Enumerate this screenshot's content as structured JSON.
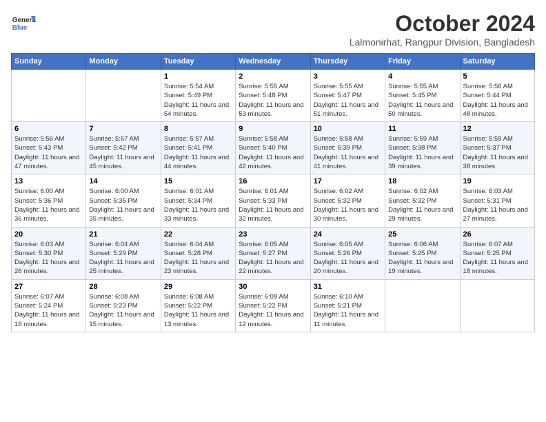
{
  "header": {
    "logo_general": "General",
    "logo_blue": "Blue",
    "month_title": "October 2024",
    "location": "Lalmonirhat, Rangpur Division, Bangladesh"
  },
  "weekdays": [
    "Sunday",
    "Monday",
    "Tuesday",
    "Wednesday",
    "Thursday",
    "Friday",
    "Saturday"
  ],
  "weeks": [
    [
      {
        "day": "",
        "sunrise": "",
        "sunset": "",
        "daylight": ""
      },
      {
        "day": "",
        "sunrise": "",
        "sunset": "",
        "daylight": ""
      },
      {
        "day": "1",
        "sunrise": "Sunrise: 5:54 AM",
        "sunset": "Sunset: 5:49 PM",
        "daylight": "Daylight: 11 hours and 54 minutes."
      },
      {
        "day": "2",
        "sunrise": "Sunrise: 5:55 AM",
        "sunset": "Sunset: 5:48 PM",
        "daylight": "Daylight: 11 hours and 53 minutes."
      },
      {
        "day": "3",
        "sunrise": "Sunrise: 5:55 AM",
        "sunset": "Sunset: 5:47 PM",
        "daylight": "Daylight: 11 hours and 51 minutes."
      },
      {
        "day": "4",
        "sunrise": "Sunrise: 5:55 AM",
        "sunset": "Sunset: 5:45 PM",
        "daylight": "Daylight: 11 hours and 50 minutes."
      },
      {
        "day": "5",
        "sunrise": "Sunrise: 5:56 AM",
        "sunset": "Sunset: 5:44 PM",
        "daylight": "Daylight: 11 hours and 48 minutes."
      }
    ],
    [
      {
        "day": "6",
        "sunrise": "Sunrise: 5:56 AM",
        "sunset": "Sunset: 5:43 PM",
        "daylight": "Daylight: 11 hours and 47 minutes."
      },
      {
        "day": "7",
        "sunrise": "Sunrise: 5:57 AM",
        "sunset": "Sunset: 5:42 PM",
        "daylight": "Daylight: 11 hours and 45 minutes."
      },
      {
        "day": "8",
        "sunrise": "Sunrise: 5:57 AM",
        "sunset": "Sunset: 5:41 PM",
        "daylight": "Daylight: 11 hours and 44 minutes."
      },
      {
        "day": "9",
        "sunrise": "Sunrise: 5:58 AM",
        "sunset": "Sunset: 5:40 PM",
        "daylight": "Daylight: 11 hours and 42 minutes."
      },
      {
        "day": "10",
        "sunrise": "Sunrise: 5:58 AM",
        "sunset": "Sunset: 5:39 PM",
        "daylight": "Daylight: 11 hours and 41 minutes."
      },
      {
        "day": "11",
        "sunrise": "Sunrise: 5:59 AM",
        "sunset": "Sunset: 5:38 PM",
        "daylight": "Daylight: 11 hours and 39 minutes."
      },
      {
        "day": "12",
        "sunrise": "Sunrise: 5:59 AM",
        "sunset": "Sunset: 5:37 PM",
        "daylight": "Daylight: 11 hours and 38 minutes."
      }
    ],
    [
      {
        "day": "13",
        "sunrise": "Sunrise: 6:00 AM",
        "sunset": "Sunset: 5:36 PM",
        "daylight": "Daylight: 11 hours and 36 minutes."
      },
      {
        "day": "14",
        "sunrise": "Sunrise: 6:00 AM",
        "sunset": "Sunset: 5:35 PM",
        "daylight": "Daylight: 11 hours and 35 minutes."
      },
      {
        "day": "15",
        "sunrise": "Sunrise: 6:01 AM",
        "sunset": "Sunset: 5:34 PM",
        "daylight": "Daylight: 11 hours and 33 minutes."
      },
      {
        "day": "16",
        "sunrise": "Sunrise: 6:01 AM",
        "sunset": "Sunset: 5:33 PM",
        "daylight": "Daylight: 11 hours and 32 minutes."
      },
      {
        "day": "17",
        "sunrise": "Sunrise: 6:02 AM",
        "sunset": "Sunset: 5:32 PM",
        "daylight": "Daylight: 11 hours and 30 minutes."
      },
      {
        "day": "18",
        "sunrise": "Sunrise: 6:02 AM",
        "sunset": "Sunset: 5:32 PM",
        "daylight": "Daylight: 11 hours and 29 minutes."
      },
      {
        "day": "19",
        "sunrise": "Sunrise: 6:03 AM",
        "sunset": "Sunset: 5:31 PM",
        "daylight": "Daylight: 11 hours and 27 minutes."
      }
    ],
    [
      {
        "day": "20",
        "sunrise": "Sunrise: 6:03 AM",
        "sunset": "Sunset: 5:30 PM",
        "daylight": "Daylight: 11 hours and 26 minutes."
      },
      {
        "day": "21",
        "sunrise": "Sunrise: 6:04 AM",
        "sunset": "Sunset: 5:29 PM",
        "daylight": "Daylight: 11 hours and 25 minutes."
      },
      {
        "day": "22",
        "sunrise": "Sunrise: 6:04 AM",
        "sunset": "Sunset: 5:28 PM",
        "daylight": "Daylight: 11 hours and 23 minutes."
      },
      {
        "day": "23",
        "sunrise": "Sunrise: 6:05 AM",
        "sunset": "Sunset: 5:27 PM",
        "daylight": "Daylight: 11 hours and 22 minutes."
      },
      {
        "day": "24",
        "sunrise": "Sunrise: 6:05 AM",
        "sunset": "Sunset: 5:26 PM",
        "daylight": "Daylight: 11 hours and 20 minutes."
      },
      {
        "day": "25",
        "sunrise": "Sunrise: 6:06 AM",
        "sunset": "Sunset: 5:25 PM",
        "daylight": "Daylight: 11 hours and 19 minutes."
      },
      {
        "day": "26",
        "sunrise": "Sunrise: 6:07 AM",
        "sunset": "Sunset: 5:25 PM",
        "daylight": "Daylight: 11 hours and 18 minutes."
      }
    ],
    [
      {
        "day": "27",
        "sunrise": "Sunrise: 6:07 AM",
        "sunset": "Sunset: 5:24 PM",
        "daylight": "Daylight: 11 hours and 16 minutes."
      },
      {
        "day": "28",
        "sunrise": "Sunrise: 6:08 AM",
        "sunset": "Sunset: 5:23 PM",
        "daylight": "Daylight: 11 hours and 15 minutes."
      },
      {
        "day": "29",
        "sunrise": "Sunrise: 6:08 AM",
        "sunset": "Sunset: 5:22 PM",
        "daylight": "Daylight: 11 hours and 13 minutes."
      },
      {
        "day": "30",
        "sunrise": "Sunrise: 6:09 AM",
        "sunset": "Sunset: 5:22 PM",
        "daylight": "Daylight: 11 hours and 12 minutes."
      },
      {
        "day": "31",
        "sunrise": "Sunrise: 6:10 AM",
        "sunset": "Sunset: 5:21 PM",
        "daylight": "Daylight: 11 hours and 11 minutes."
      },
      {
        "day": "",
        "sunrise": "",
        "sunset": "",
        "daylight": ""
      },
      {
        "day": "",
        "sunrise": "",
        "sunset": "",
        "daylight": ""
      }
    ]
  ]
}
